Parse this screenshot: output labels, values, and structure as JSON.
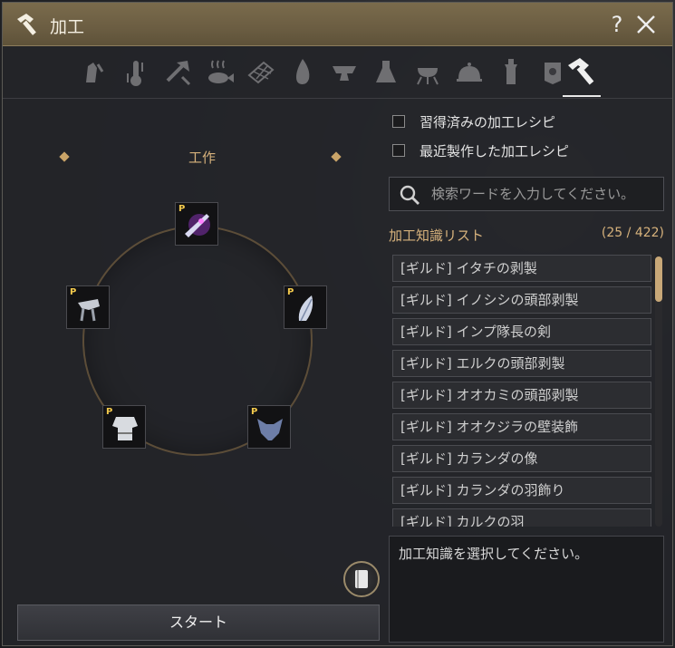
{
  "window": {
    "title": "加工",
    "help_label": "?"
  },
  "categories": [
    {
      "name": "gathering",
      "active": false
    },
    {
      "name": "alchemy-temperature",
      "active": false
    },
    {
      "name": "axe-woodcutting",
      "active": false
    },
    {
      "name": "fishing",
      "active": false
    },
    {
      "name": "hunting-net",
      "active": false
    },
    {
      "name": "fire",
      "active": false
    },
    {
      "name": "anvil",
      "active": false
    },
    {
      "name": "flask",
      "active": false
    },
    {
      "name": "grill",
      "active": false
    },
    {
      "name": "cooking-cloche",
      "active": false
    },
    {
      "name": "tower",
      "active": false
    },
    {
      "name": "trading",
      "active": false
    },
    {
      "name": "hammer",
      "active": true
    }
  ],
  "craft": {
    "title": "工作",
    "slots": [
      {
        "name": "top",
        "badge": "P"
      },
      {
        "name": "left",
        "badge": "P"
      },
      {
        "name": "right",
        "badge": "P"
      },
      {
        "name": "bottom-left",
        "badge": "P"
      },
      {
        "name": "bottom-right",
        "badge": "P"
      }
    ],
    "start_label": "スタート"
  },
  "filters": {
    "learned_label": "習得済みの加工レシピ",
    "recent_label": "最近製作した加工レシピ"
  },
  "search": {
    "placeholder": "検索ワードを入力してください。"
  },
  "knowledge_list": {
    "title": "加工知識リスト",
    "count": "(25 / 422)",
    "items": [
      "[ギルド] イタチの剥製",
      "[ギルド] イノシシの頭部剥製",
      "[ギルド] インプ隊長の剣",
      "[ギルド] エルクの頭部剥製",
      "[ギルド] オオカミの頭部剥製",
      "[ギルド] オオクジラの壁装飾",
      "[ギルド] カランダの像",
      "[ギルド] カランダの羽飾り",
      "[ギルド] カルクの羽"
    ]
  },
  "description": {
    "text": "加工知識を選択してください。"
  },
  "colors": {
    "title_bar": "#6b5d42",
    "accent_gold": "#d7b27c",
    "badge": "#f2c94c"
  }
}
